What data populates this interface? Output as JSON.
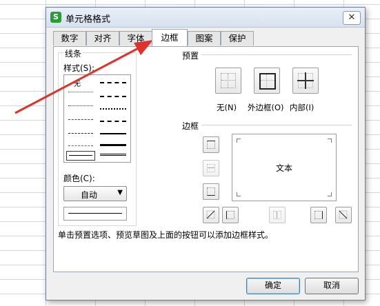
{
  "dialog": {
    "title": "单元格格式",
    "app_icon_letter": "S",
    "close_glyph": "✕"
  },
  "tabs": [
    {
      "label": "数字"
    },
    {
      "label": "对齐"
    },
    {
      "label": "字体"
    },
    {
      "label": "边框",
      "active": true
    },
    {
      "label": "图案"
    },
    {
      "label": "保护"
    }
  ],
  "line_group": {
    "title": "线条",
    "style_label": "样式(S):",
    "none_label": "无",
    "color_label": "颜色(C):",
    "color_value": "自动",
    "dropdown_glyph": "▼"
  },
  "presets": {
    "title": "预置",
    "items": [
      {
        "label": "无(N)",
        "icon": "border-none-icon"
      },
      {
        "label": "外边框(O)",
        "icon": "border-outline-icon"
      },
      {
        "label": "内部(I)",
        "icon": "border-inside-icon"
      }
    ]
  },
  "border": {
    "title": "边框",
    "preview_text": "文本"
  },
  "hint": "单击预置选项、预览草图及上面的按钮可以添加边框样式。",
  "buttons": {
    "ok": "确定",
    "cancel": "取消"
  },
  "colors": {
    "annotation_arrow": "#e0312b",
    "dialog_bg": "#f0f0f0",
    "app_icon": "#2d9b3b"
  }
}
